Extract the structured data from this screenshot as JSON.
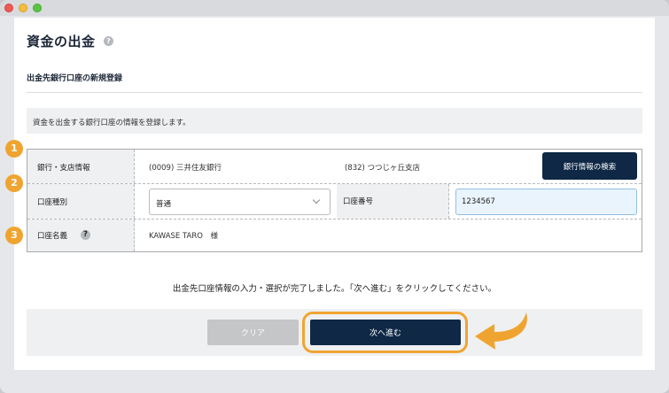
{
  "page": {
    "title": "資金の出金",
    "section_title": "出金先銀行口座の新規登録",
    "notice": "資金を出金する銀行口座の情報を登録します。",
    "instruction": "出金先口座情報の入力・選択が完了しました。「次へ進む」をクリックしてください。"
  },
  "form": {
    "bank": {
      "step": "1",
      "label": "銀行・支店情報",
      "bank_value": "(0009) 三井住友銀行",
      "branch_value": "(832) つつじヶ丘支店",
      "search_button": "銀行情報の検索"
    },
    "account_type": {
      "step": "2",
      "label": "口座種別",
      "selected": "普通",
      "number_label": "口座番号",
      "number_value": "1234567"
    },
    "holder": {
      "step": "3",
      "label": "口座名義",
      "value": "KAWASE TARO　様"
    }
  },
  "actions": {
    "clear_label": "クリア",
    "next_label": "次へ進む"
  },
  "icons": {
    "help": "?"
  },
  "colors": {
    "accent_orange": "#f0a430",
    "primary_navy": "#0e2846",
    "disabled_gray": "#c5c6c8"
  }
}
